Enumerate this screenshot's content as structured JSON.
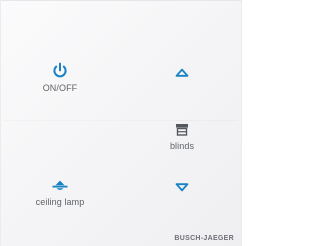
{
  "colors": {
    "accent": "#1a82c4",
    "icon_gray": "#55585e",
    "label": "#5f6268"
  },
  "controls": {
    "onoff": {
      "label": "ON/OFF",
      "icon": "power-icon"
    },
    "blinds_up": {
      "icon": "triangle-up-icon"
    },
    "blinds": {
      "label": "blinds",
      "icon": "blinds-icon"
    },
    "ceiling_lamp": {
      "label": "ceiling lamp",
      "icon": "ceiling-lamp-icon"
    },
    "blinds_down": {
      "icon": "triangle-down-icon"
    }
  },
  "brand": "BUSCH-JAEGER"
}
